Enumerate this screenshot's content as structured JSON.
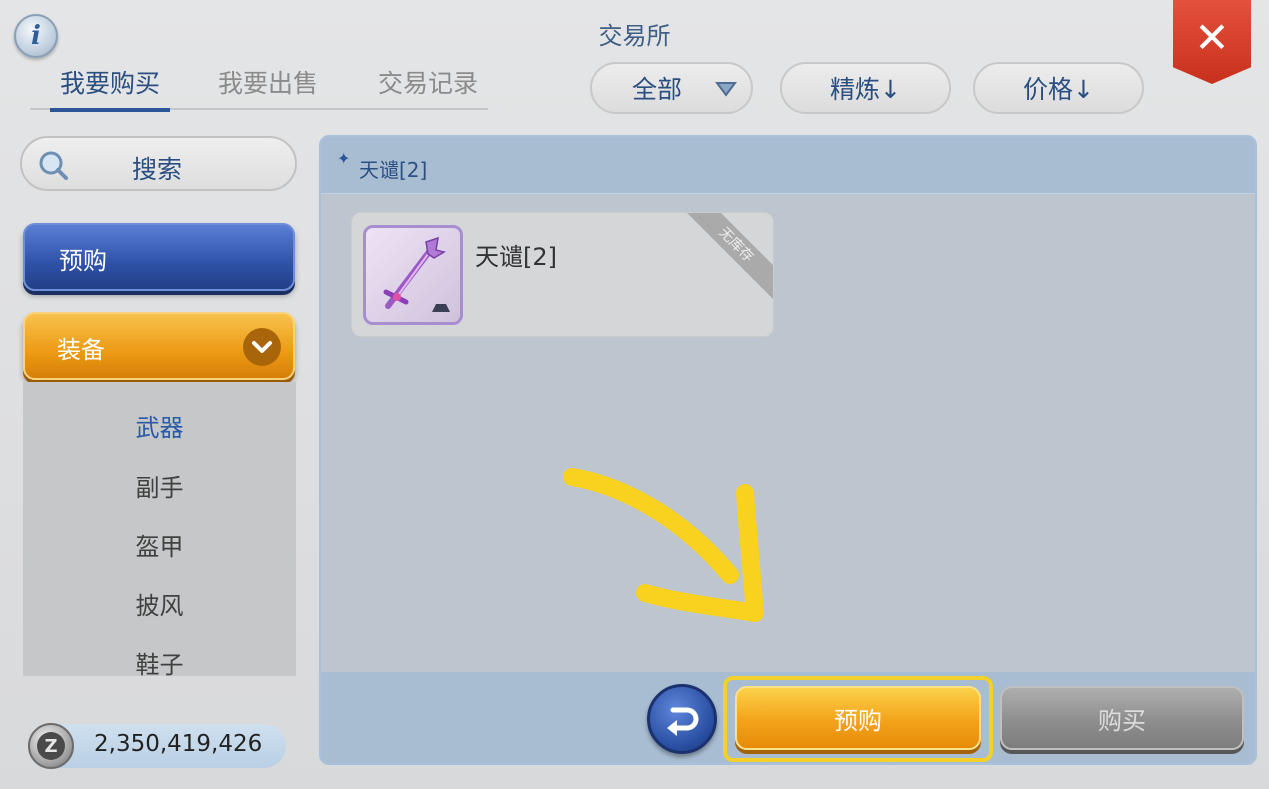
{
  "header": {
    "title": "交易所",
    "info_icon": "i",
    "close_icon": "✕"
  },
  "tabs": [
    {
      "label": "我要购买",
      "active": true
    },
    {
      "label": "我要出售",
      "active": false
    },
    {
      "label": "交易记录",
      "active": false
    }
  ],
  "filters": {
    "category_dropdown": "全部",
    "refine_sort": "精炼↓",
    "price_sort": "价格↓"
  },
  "sidebar": {
    "search_label": "搜索",
    "preorder_label": "预购",
    "category_label": "装备",
    "subcategories": [
      {
        "label": "武器",
        "active": true
      },
      {
        "label": "副手",
        "active": false
      },
      {
        "label": "盔甲",
        "active": false
      },
      {
        "label": "披风",
        "active": false
      },
      {
        "label": "鞋子",
        "active": false
      }
    ]
  },
  "currency": {
    "amount": "2,350,419,426",
    "coin_symbol": "Z"
  },
  "content": {
    "header_label": "天谴[2]",
    "items": [
      {
        "name": "天谴[2]",
        "badge": "无库存"
      }
    ]
  },
  "footer": {
    "preorder_label": "预购",
    "buy_label": "购买"
  },
  "colors": {
    "accent_blue": "#2c5599",
    "orange": "#ec9a14",
    "close_red": "#d43a24",
    "highlight_yellow": "#f4d02c"
  }
}
